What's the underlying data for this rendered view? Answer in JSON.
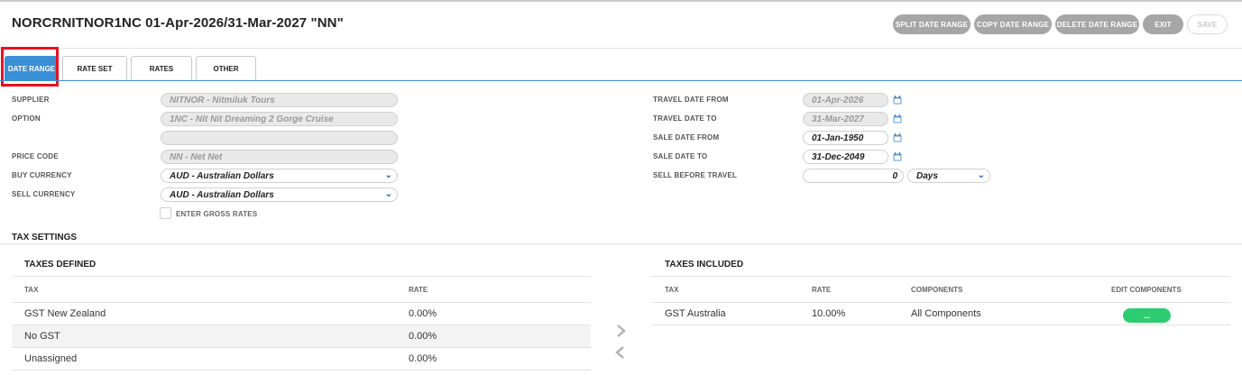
{
  "header": {
    "title": "NORCRNITNOR1NC 01-Apr-2026/31-Mar-2027 \"NN\"",
    "actions": {
      "split": "SPLIT DATE RANGE",
      "copy": "COPY DATE RANGE",
      "delete": "DELETE DATE RANGE",
      "exit": "EXIT",
      "save": "SAVE"
    }
  },
  "tabs": {
    "date_range": "DATE RANGE",
    "rate_set": "RATE SET",
    "rates": "RATES",
    "other": "OTHER",
    "active": "DATE RANGE"
  },
  "form_left": {
    "supplier_label": "SUPPLIER",
    "supplier_value": "NITNOR - Nitmiluk Tours",
    "option_label": "OPTION",
    "option_value": "1NC - Nit Nit Dreaming 2 Gorge Cruise",
    "option_extra_value": "",
    "price_code_label": "PRICE CODE",
    "price_code_value": "NN - Net Net",
    "buy_currency_label": "BUY CURRENCY",
    "buy_currency_value": "AUD - Australian Dollars",
    "sell_currency_label": "SELL CURRENCY",
    "sell_currency_value": "AUD - Australian Dollars",
    "gross_rates_label": "ENTER GROSS RATES"
  },
  "form_right": {
    "travel_from_label": "TRAVEL DATE FROM",
    "travel_from_value": "01-Apr-2026",
    "travel_to_label": "TRAVEL DATE TO",
    "travel_to_value": "31-Mar-2027",
    "sale_from_label": "SALE DATE FROM",
    "sale_from_value": "01-Jan-1950",
    "sale_to_label": "SALE DATE TO",
    "sale_to_value": "31-Dec-2049",
    "sell_before_label": "SELL BEFORE TRAVEL",
    "sell_before_value": "0",
    "sell_before_unit": "Days"
  },
  "tax_settings": {
    "title": "TAX SETTINGS",
    "defined": {
      "title": "TAXES DEFINED",
      "col_tax": "TAX",
      "col_rate": "RATE",
      "rows": [
        {
          "tax": "GST New Zealand",
          "rate": "0.00%"
        },
        {
          "tax": "No GST",
          "rate": "0.00%"
        },
        {
          "tax": "Unassigned",
          "rate": "0.00%"
        }
      ]
    },
    "included": {
      "title": "TAXES INCLUDED",
      "col_tax": "TAX",
      "col_rate": "RATE",
      "col_components": "COMPONENTS",
      "col_edit": "EDIT COMPONENTS",
      "rows": [
        {
          "tax": "GST Australia",
          "rate": "10.00%",
          "components": "All Components",
          "edit_label": "..."
        }
      ]
    }
  },
  "colors": {
    "accent": "#3a8fd6",
    "highlight": "#e8121f",
    "button_gray": "#a6a6a6",
    "edit_green": "#2ecc71"
  },
  "icons": {
    "calendar": "calendar-icon",
    "dropdown": "chevron-down-icon",
    "move_right": "chevron-right-icon",
    "move_left": "chevron-left-icon"
  }
}
